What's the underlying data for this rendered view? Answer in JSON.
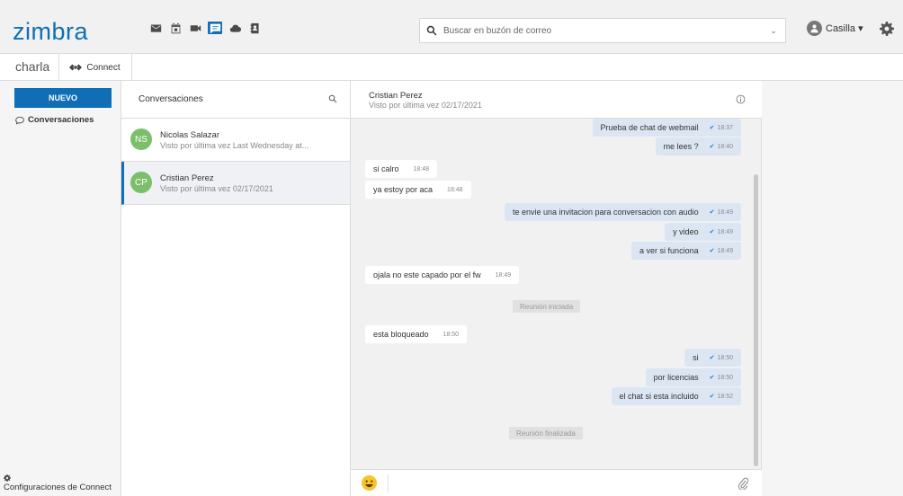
{
  "brand": {
    "logo": "zimbra"
  },
  "apps": [
    {
      "name": "mail-icon",
      "active": false
    },
    {
      "name": "calendar-icon",
      "active": false
    },
    {
      "name": "video-icon",
      "active": false
    },
    {
      "name": "chat-icon",
      "active": true
    },
    {
      "name": "cloud-icon",
      "active": false
    },
    {
      "name": "contacts-icon",
      "active": false
    }
  ],
  "search": {
    "placeholder": "Buscar en buzón de correo"
  },
  "user": {
    "label": "Casilla ▾"
  },
  "subbar": {
    "title": "charla",
    "tab_label": "Connect"
  },
  "sidebar": {
    "new_button": "NUEVO",
    "conversations_label": "Conversaciones",
    "settings_label": "Configuraciones de Connect"
  },
  "conversations": {
    "header": "Conversaciones",
    "items": [
      {
        "initials": "NS",
        "name": "Nicolas Salazar",
        "status": "Visto por última vez Last Wednesday at...",
        "selected": false
      },
      {
        "initials": "CP",
        "name": "Cristian Perez",
        "status": "Visto por última vez 02/17/2021",
        "selected": true
      }
    ]
  },
  "chat": {
    "contact_name": "Cristian Perez",
    "last_seen": "Visto por última vez 02/17/2021",
    "messages": [
      {
        "dir": "out",
        "text": "Prueba de chat de webmail",
        "time": "18:37"
      },
      {
        "dir": "out",
        "text": "me lees ?",
        "time": "18:40"
      },
      {
        "dir": "in",
        "text": "si calro",
        "time": "18:48"
      },
      {
        "dir": "in",
        "text": "ya estoy por aca",
        "time": "18:48"
      },
      {
        "dir": "out",
        "text": "te envie una invitacion para conversacion con audio",
        "time": "18:49"
      },
      {
        "dir": "out",
        "text": "y video",
        "time": "18:49"
      },
      {
        "dir": "out",
        "text": "a ver si funciona",
        "time": "18:49"
      },
      {
        "dir": "in",
        "text": "ojala no este capado por el fw",
        "time": "18:49"
      },
      {
        "dir": "sys",
        "text": "Reunión iniciada"
      },
      {
        "dir": "in",
        "text": "esta bloqueado",
        "time": "18:50"
      },
      {
        "dir": "out",
        "text": "si",
        "time": "18:50"
      },
      {
        "dir": "out",
        "text": "por licencias",
        "time": "18:50"
      },
      {
        "dir": "out",
        "text": "el chat si esta incluido",
        "time": "18:52"
      },
      {
        "dir": "sys",
        "text": "Reunión finalizada"
      }
    ]
  },
  "colors": {
    "accent": "#0f6eb6",
    "avatar": "#7bbf6a",
    "outgoing_bubble": "#dce6f3",
    "incoming_bubble": "#ffffff"
  }
}
